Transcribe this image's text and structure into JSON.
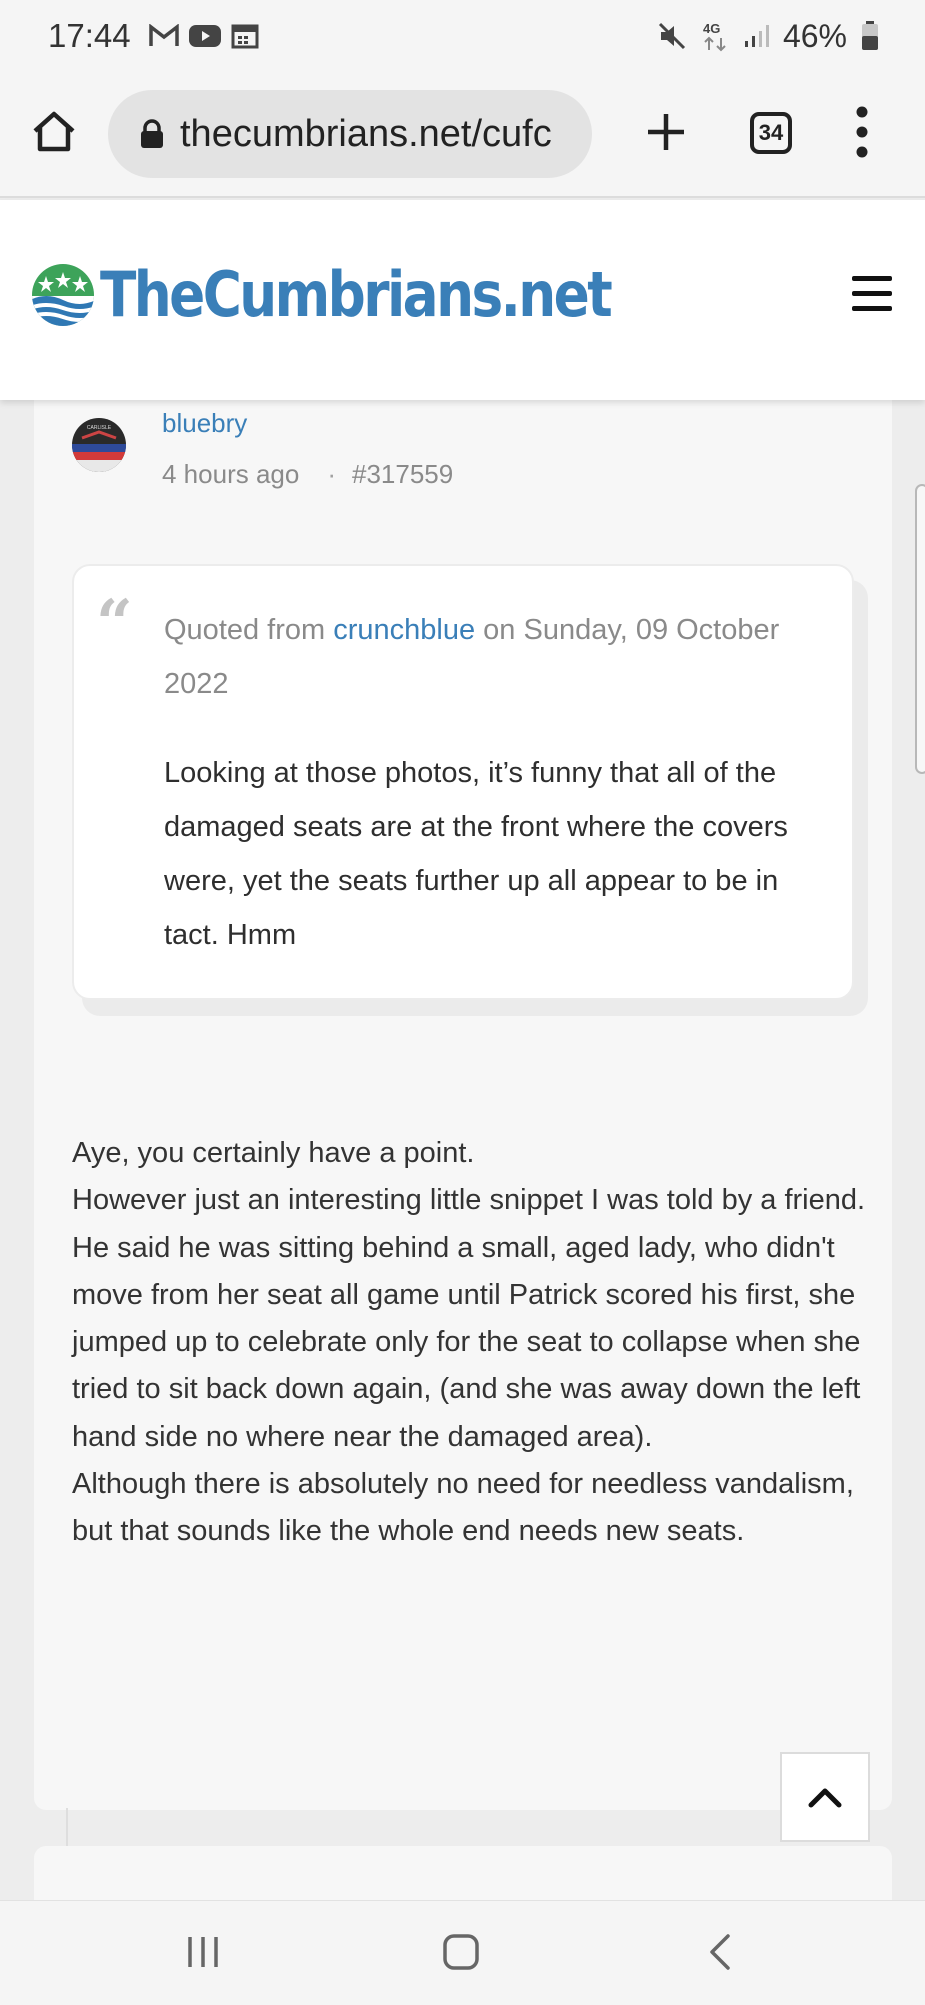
{
  "status_bar": {
    "time": "17:44",
    "network": "4G",
    "battery": "46%",
    "icons": [
      "gmail-icon",
      "youtube-icon",
      "calendar-icon",
      "mute-icon",
      "network-icon",
      "signal-icon",
      "battery-icon"
    ]
  },
  "browser": {
    "url": "thecumbrians.net/cufc",
    "tab_count": "34"
  },
  "site": {
    "logo_text": "TheCumbrians.net"
  },
  "post": {
    "author": "bluebry",
    "time_ago": "4 hours ago",
    "separator": "·",
    "post_id": "#317559",
    "quote": {
      "prefix": "Quoted from ",
      "user": "crunchblue",
      "suffix": " on Sunday, 09 October 2022",
      "text": "Looking at those photos, it’s funny that all of the damaged seats are at the front where the covers were, yet the seats further up all appear to be in tact. Hmm"
    },
    "body": [
      "Aye, you certainly have a point.",
      "However just an interesting little snippet I was told by a friend.",
      "He said he was sitting behind a small, aged lady, who didn't move from her seat all game until Patrick scored his first, she jumped up to celebrate only for the seat to collapse when she tried to sit back down again, (and she was away down the left hand side no where near the damaged area).",
      "Although there is absolutely no need for needless vandalism, but that sounds like the whole end needs new seats."
    ]
  },
  "colors": {
    "brand": "#3a7fb8",
    "link": "#3a7fb8",
    "meta": "#8a8a8a"
  }
}
